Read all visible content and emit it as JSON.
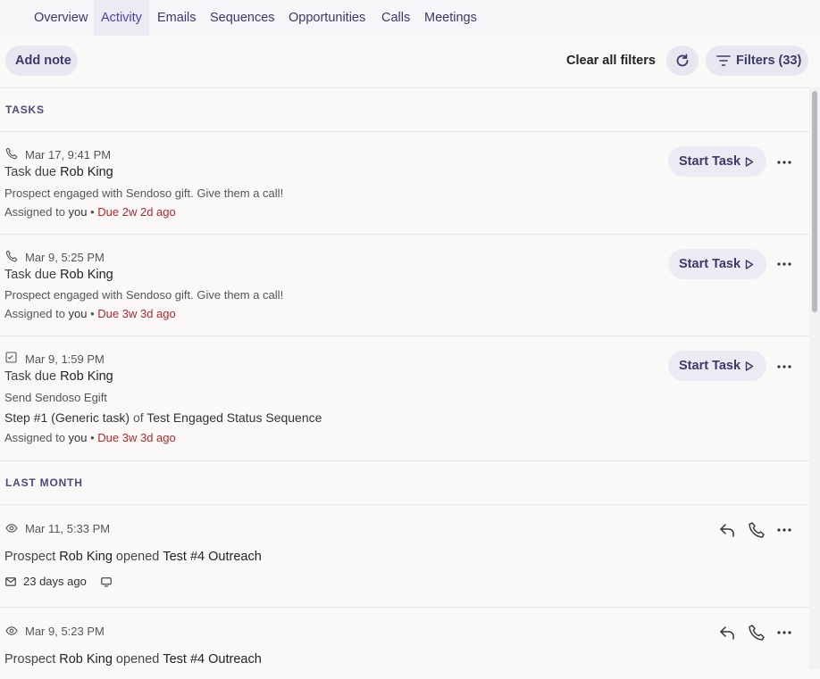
{
  "tabs": [
    {
      "label": "Overview",
      "active": false
    },
    {
      "label": "Activity",
      "active": true
    },
    {
      "label": "Emails",
      "active": false
    },
    {
      "label": "Sequences",
      "active": false
    },
    {
      "label": "Opportunities",
      "active": false
    },
    {
      "label": "Calls",
      "active": false
    },
    {
      "label": "Meetings",
      "active": false
    }
  ],
  "toolbar": {
    "add_note": "Add note",
    "clear_filters": "Clear all filters",
    "refresh_icon": "refresh-icon",
    "filters_label": "Filters (33)"
  },
  "sections": {
    "tasks": "TASKS",
    "last_month": "LAST MONTH"
  },
  "tasks": [
    {
      "icon": "phone-icon",
      "date": "Mar 17, 9:41 PM",
      "title_prefix": "Task due ",
      "name": "Rob King",
      "note": "Prospect engaged with Sendoso gift. Give them a call!",
      "assigned": "Assigned to ",
      "assignee": "you",
      "sep": " • ",
      "due": "Due 2w 2d ago",
      "action": "Start Task"
    },
    {
      "icon": "phone-icon",
      "date": "Mar 9, 5:25 PM",
      "title_prefix": "Task due ",
      "name": "Rob King",
      "note": "Prospect engaged with Sendoso gift. Give them a call!",
      "assigned": "Assigned to ",
      "assignee": "you",
      "sep": " • ",
      "due": "Due 3w 3d ago",
      "action": "Start Task"
    },
    {
      "icon": "checklist-icon",
      "date": "Mar 9, 1:59 PM",
      "title_prefix": "Task due ",
      "name": "Rob King",
      "note": "Send Sendoso Egift",
      "step": "Step #1 (Generic task)",
      "step_of": " of ",
      "sequence": "Test Engaged Status Sequence",
      "assigned": "Assigned to ",
      "assignee": "you",
      "sep": " • ",
      "due": "Due 3w 3d ago",
      "action": "Start Task"
    }
  ],
  "activities": [
    {
      "icon": "eye-icon",
      "date": "Mar 11, 5:33 PM",
      "prefix": "Prospect ",
      "name": "Rob King",
      "verb": " opened ",
      "subject": "Test #4 Outreach",
      "ago": "23 days ago"
    },
    {
      "icon": "eye-icon",
      "date": "Mar 9, 5:23 PM",
      "prefix": "Prospect ",
      "name": "Rob King",
      "verb": " opened ",
      "subject": "Test #4 Outreach"
    }
  ],
  "colors": {
    "accent": "#4a44a8",
    "due": "#b3262d",
    "pill_bg": "#e8e7ef"
  }
}
